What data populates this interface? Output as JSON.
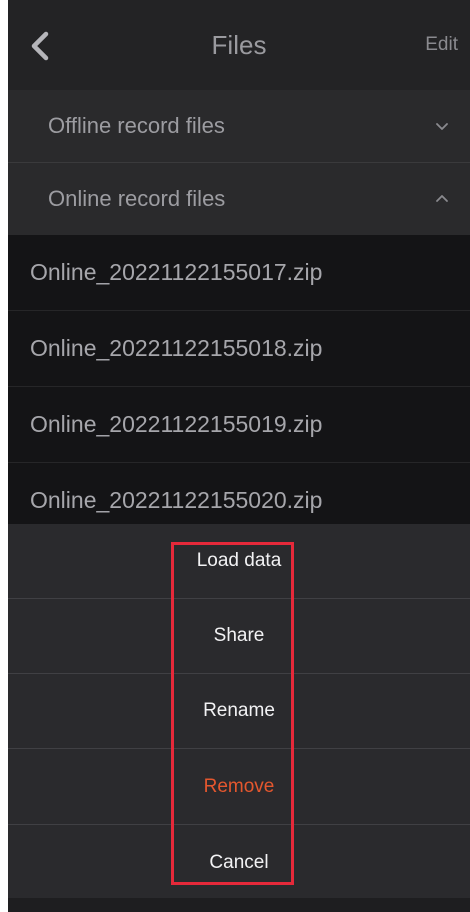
{
  "header": {
    "title": "Files",
    "edit_label": "Edit"
  },
  "sections": {
    "offline": {
      "label": "Offline record files",
      "expanded": false
    },
    "online": {
      "label": "Online record files",
      "expanded": true
    }
  },
  "files": [
    "Online_20221122155017.zip",
    "Online_20221122155018.zip",
    "Online_20221122155019.zip",
    "Online_20221122155020.zip"
  ],
  "action_sheet": {
    "load": "Load data",
    "share": "Share",
    "rename": "Rename",
    "remove": "Remove",
    "cancel": "Cancel"
  },
  "colors": {
    "background": "#1c1c1e",
    "remove_text": "#e4572e",
    "highlight_border": "#e5293a"
  }
}
